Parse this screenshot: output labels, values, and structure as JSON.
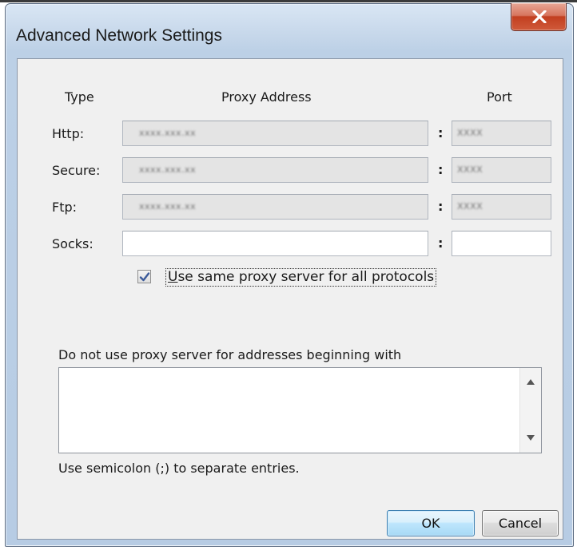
{
  "window": {
    "title": "Advanced Network Settings",
    "close_icon": "close-x-icon"
  },
  "headers": {
    "type": "Type",
    "proxy_address": "Proxy Address",
    "port": "Port"
  },
  "rows": [
    {
      "label": "Http:",
      "address": "xxxx.xxx.xx",
      "port": "XXXX",
      "enabled": false
    },
    {
      "label": "Secure:",
      "address": "xxxx.xxx.xx",
      "port": "XXXX",
      "enabled": false
    },
    {
      "label": "Ftp:",
      "address": "xxxx.xxx.xx",
      "port": "XXXX",
      "enabled": false
    },
    {
      "label": "Socks:",
      "address": "",
      "port": "",
      "enabled": true
    }
  ],
  "separator": ":",
  "same_proxy": {
    "checked": true,
    "label_underlined": "U",
    "label_rest": "se same proxy server for all protocols"
  },
  "exceptions": {
    "label": "Do not use proxy server for addresses beginning with",
    "value": "",
    "hint": "Use semicolon (;) to separate entries."
  },
  "buttons": {
    "ok": "OK",
    "cancel": "Cancel"
  }
}
